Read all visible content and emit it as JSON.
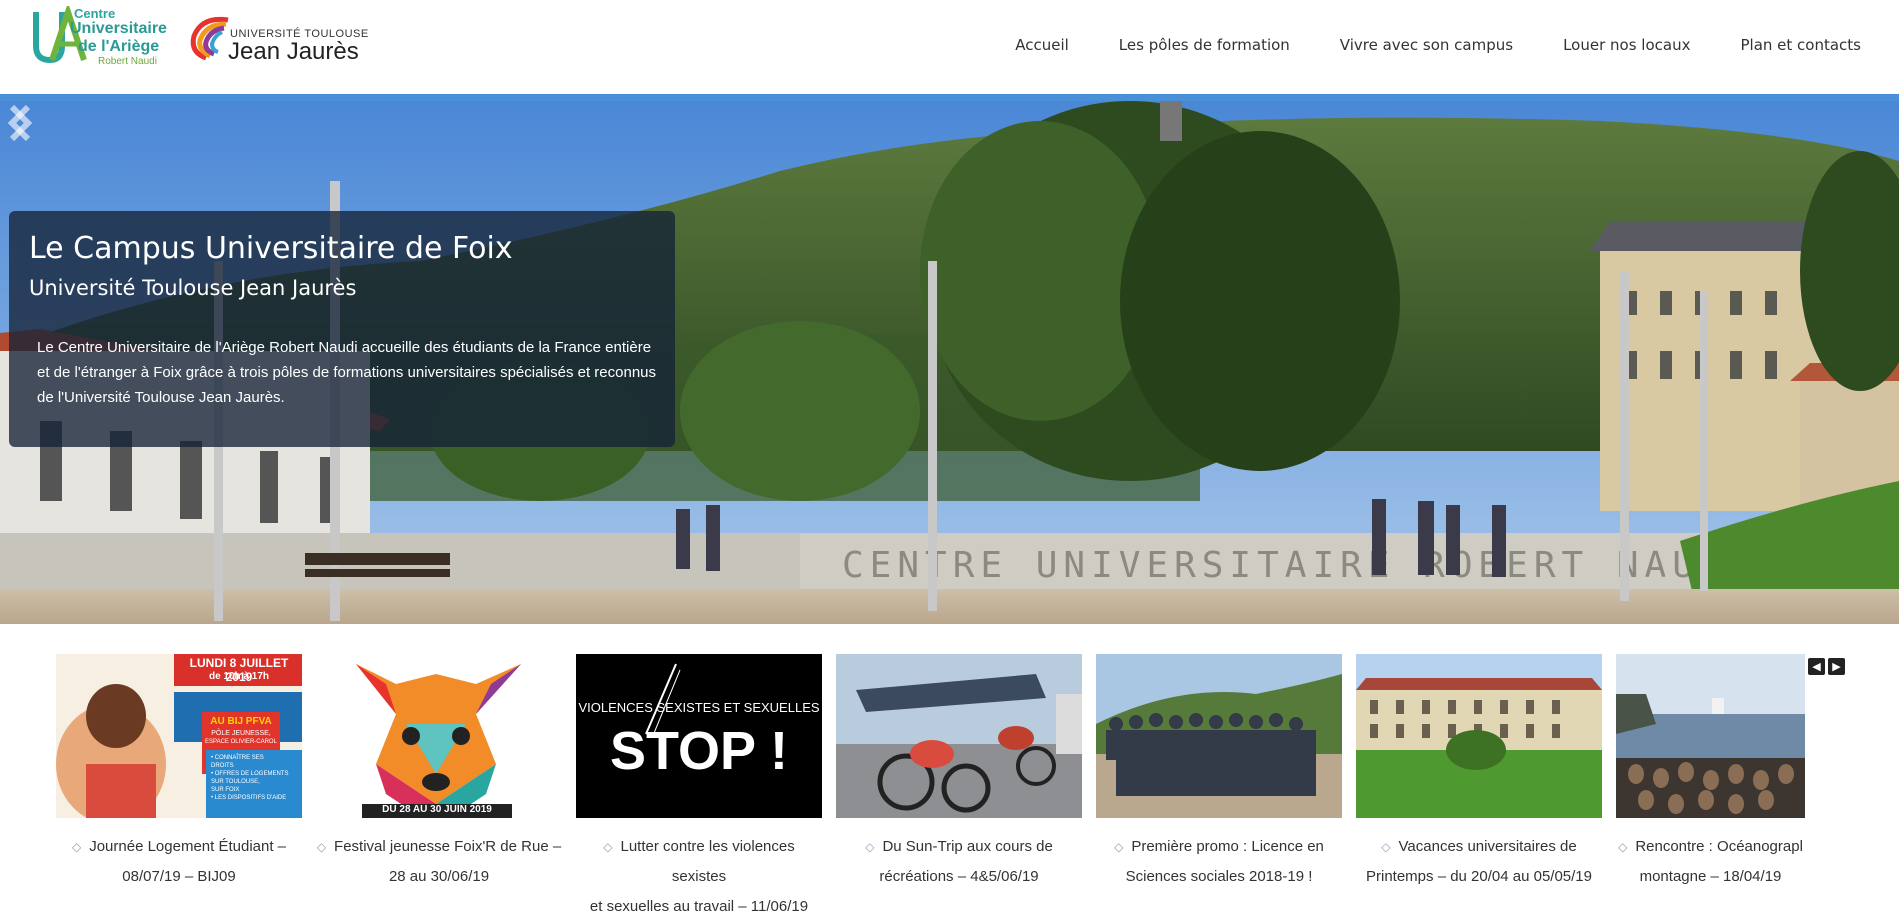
{
  "header": {
    "logo_cua": {
      "line1": "Centre",
      "line2": "Universitaire",
      "line3": "de l'Ariège",
      "line4": "Robert Naudi"
    },
    "logo_utj": {
      "line1": "UNIVERSITÉ TOULOUSE",
      "line2": "Jean Jaurès"
    },
    "nav": [
      {
        "label": "Accueil"
      },
      {
        "label": "Les pôles de formation"
      },
      {
        "label": "Vivre avec son campus"
      },
      {
        "label": "Louer nos locaux"
      },
      {
        "label": "Plan et contacts"
      }
    ]
  },
  "hero": {
    "title": "Le Campus Universitaire de Foix",
    "subtitle": "Université Toulouse Jean Jaurès",
    "description": "Le Centre Universitaire de l'Ariège Robert Naudi accueille des étudiants de la France entière et de l'étranger à Foix grâce à trois pôles de formations universitaires spécialisés et reconnus de l'Université Toulouse Jean Jaurès.",
    "wall_text": "CENTRE UNIVERSITAIRE ROBERT NAUDI",
    "slide_count": 6,
    "active_slide": 5,
    "prev_icon": "chevron-left-icon",
    "next_icon": "chevron-right-icon"
  },
  "news": {
    "prev_label": "◀",
    "next_label": "▶",
    "items": [
      {
        "title_l1": "Journée Logement Étudiant –",
        "title_l2": "08/07/19 – BIJ09",
        "poster_date": "LUNDI 8 JUILLET 2019",
        "poster_time": "de 10h à 17h",
        "poster_box1": "AU BIJ PFVA",
        "poster_box2": "PÔLE JEUNESSE,",
        "poster_box3": "ESPACE OLIVIER-CAROL",
        "poster_b1": "• CONNAÎTRE SES",
        "poster_b2": "DROITS",
        "poster_b3": "• OFFRES DE LOGEMENTS",
        "poster_b4": "SUR TOULOUSE,",
        "poster_b5": "SUR FOIX",
        "poster_b6": "• LES DISPOSITIFS D'AIDE"
      },
      {
        "title_l1": "Festival jeunesse Foix'R de Rue –",
        "title_l2": "28 au 30/06/19",
        "poster_date": "DU 28 AU 30 JUIN 2019"
      },
      {
        "title_l1": "Lutter contre les violences sexistes",
        "title_l2": "et sexuelles au travail – 11/06/19",
        "poster_head": "VIOLENCES SEXISTES ET SEXUELLES",
        "poster_main": "STOP !"
      },
      {
        "title_l1": "Du Sun-Trip aux cours de",
        "title_l2": "récréations – 4&5/06/19"
      },
      {
        "title_l1": "Première promo : Licence en",
        "title_l2": "Sciences sociales 2018-19 !"
      },
      {
        "title_l1": "Vacances universitaires de",
        "title_l2": "Printemps – du 20/04 au 05/05/19"
      },
      {
        "title_l1": "Rencontre : Océanograpl",
        "title_l2": "montagne – 18/04/19"
      }
    ]
  },
  "colors": {
    "accent_stripe": "#4a90d9",
    "caption_bg": "#142337",
    "teal_logo": "#2aa6a0"
  }
}
